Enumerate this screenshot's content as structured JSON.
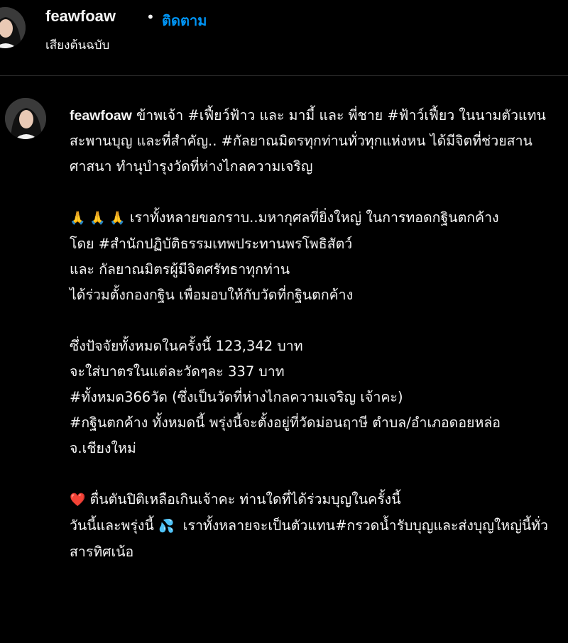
{
  "header": {
    "username": "feawfoaw",
    "separator": "•",
    "follow_label": "ติดตาม",
    "audio_label": "เสียงต้นฉบับ"
  },
  "caption": {
    "username": "feawfoaw",
    "p1": " ข้าพเจ้า #เฟี้ยว์ฟ้าว และ มามี้ และ พี่ชาย #ฟ้าว์เฟี้ยว ในนามตัวแทนสะพานบุญ และที่สำคัญ.. #กัลยาณมิตรทุกท่านทั่วทุกแห่งหน ได้มีจิตที่ช่วยสานศาสนา ทำนุบำรุงวัดที่ห่างไกลความเจริญ",
    "p2_emoji": "🙏 🙏 🙏",
    "p2_line1": " เราทั้งหลายขอกราบ..มหากุศลที่ยิ่งใหญ่ ในการทอดกฐินตกค้าง",
    "p2_line2": "โดย #สำนักปฏิบัติธรรมเทพประทานพรโพธิสัตว์",
    "p2_line3": "และ กัลยาณมิตรผู้มีจิตศรัทธาทุกท่าน",
    "p2_line4": "ได้ร่วมตั้งกองกฐิน เพื่อมอบให้กับวัดที่กฐินตกค้าง",
    "p3_line1": "ซึ่งปัจจัยทั้งหมดในครั้งนี้ 123,342 บาท",
    "p3_line2": "จะใส่บาตรในแต่ละวัดๆละ 337 บาท",
    "p3_line3": "#ทั้งหมด366วัด (ซึ่งเป็นวัดที่ห่างไกลความเจริญ เจ้าคะ)",
    "p3_line4": "#กฐินตกค้าง ทั้งหมดนี้ พรุ่งนี้จะตั้งอยู่ที่วัดม่อนฤาษี ตำบล/อำเภอดอยหล่อ จ.เชียงใหม่",
    "p4_emoji1": "❤️",
    "p4_text1": " ตื่นตันปิติเหลือเกินเจ้าคะ ท่านใดที่ได้ร่วมบุญในครั้งนี้",
    "p4_text2a": "วันนี้และพรุ่งนี้ ",
    "p4_emoji2": "💦",
    "p4_text2b": "  เราทั้งหลายจะเป็นตัวแทน#กรวดน้ำรับบุญและส่งบุญใหญ่นี้ทั่วสารทิศเน้อ"
  }
}
